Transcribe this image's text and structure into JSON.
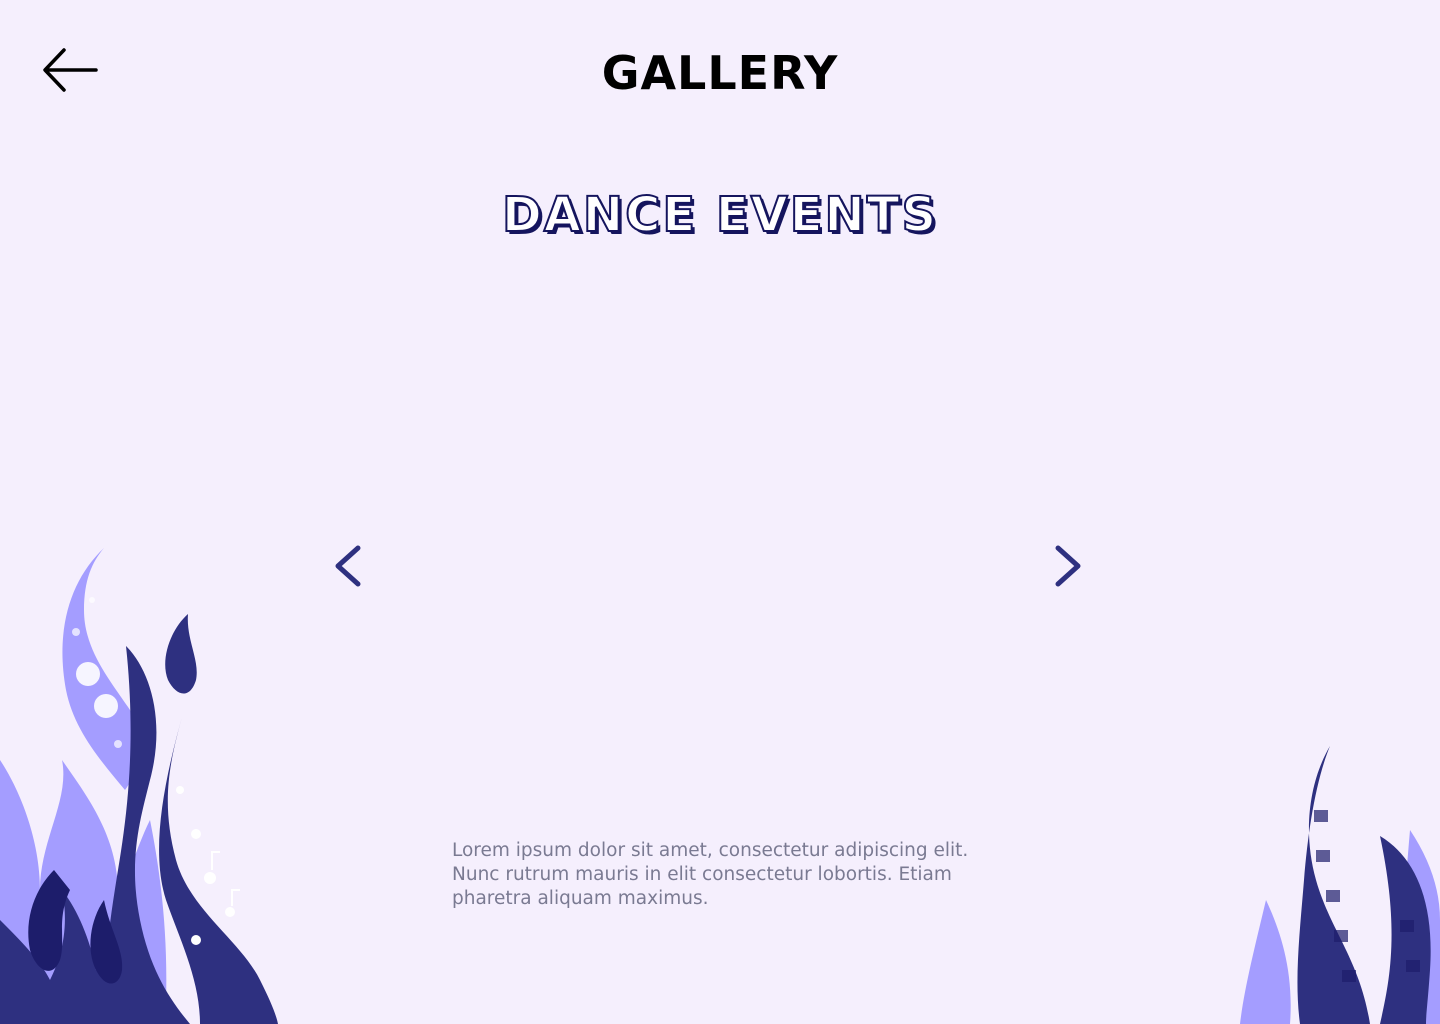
{
  "header": {
    "title": "GALLERY",
    "back_icon": "arrow-left-icon"
  },
  "gallery": {
    "section_title": "DANCE EVENTS",
    "prev_icon": "chevron-left-icon",
    "next_icon": "chevron-right-icon",
    "description": "Lorem ipsum dolor sit amet, consectetur adipiscing elit. Nunc rutrum mauris in elit consectetur lobortis. Etiam pharetra aliquam maximus."
  },
  "colors": {
    "background": "#f5effd",
    "navy": "#2e3080",
    "dark_navy": "#1d1d6b",
    "lavender": "#a49dff",
    "text_gray": "#7a7a92",
    "title": "#000000"
  }
}
